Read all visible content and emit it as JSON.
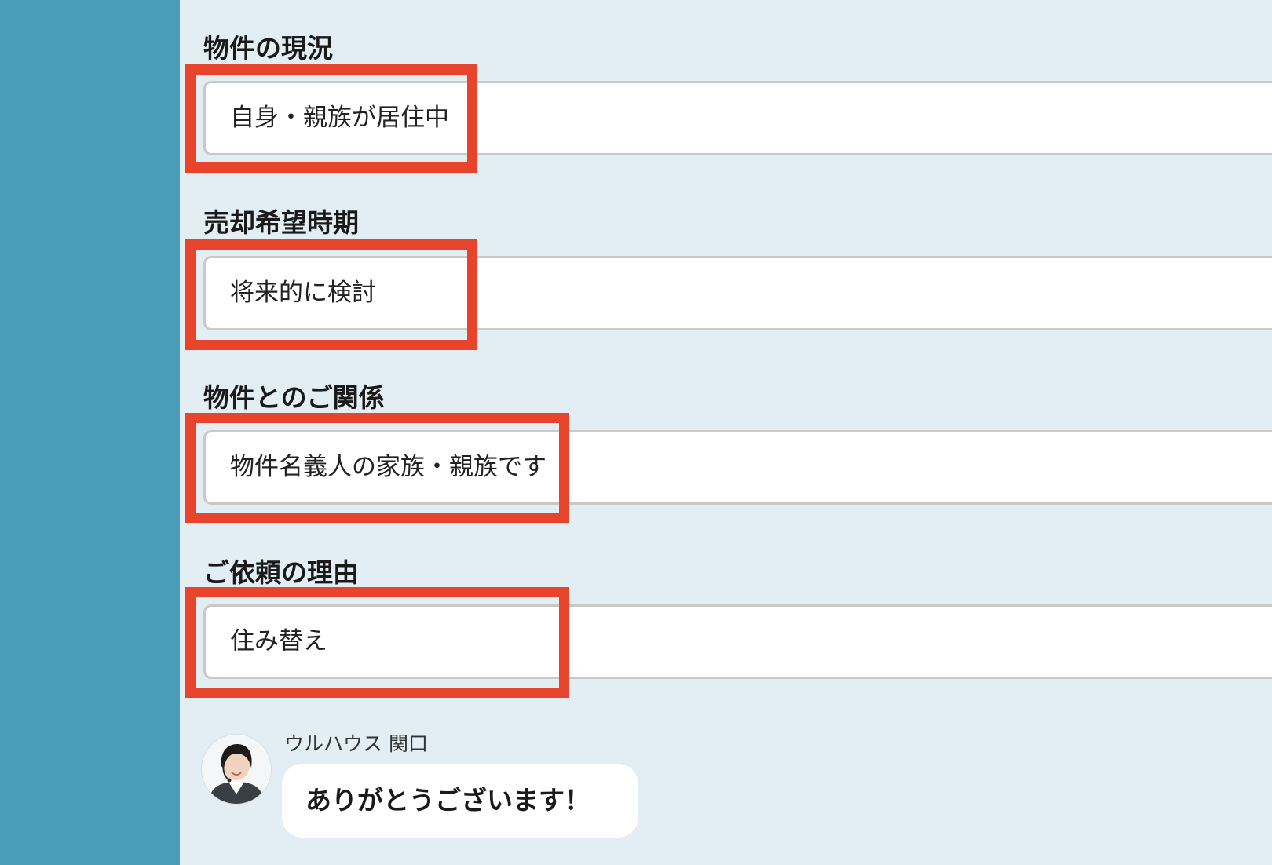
{
  "fields": [
    {
      "label": "物件の現況",
      "value": "自身・親族が居住中"
    },
    {
      "label": "売却希望時期",
      "value": "将来的に検討"
    },
    {
      "label": "物件とのご関係",
      "value": "物件名義人の家族・親族です"
    },
    {
      "label": "ご依頼の理由",
      "value": "住み替え"
    }
  ],
  "chat": {
    "sender": "ウルハウス 関口",
    "message": "ありがとうございます！"
  },
  "colors": {
    "sidebar": "#4a9db8",
    "background": "#e3eef4",
    "highlight": "#e8432b"
  }
}
